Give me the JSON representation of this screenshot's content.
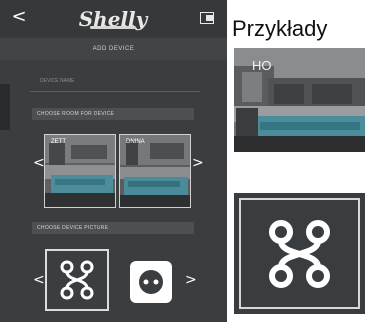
{
  "app": {
    "back_glyph": "<",
    "logo": "Shelly",
    "screen_title": "ADD DEVICE",
    "name_placeholder": "DEVICE NAME",
    "fullscreen_icon": "fullscreen-toggle-icon"
  },
  "rooms_section": {
    "label": "CHOOSE ROOM FOR DEVICE",
    "prev": "<",
    "next": ">",
    "rooms": [
      {
        "label": "ZETT"
      },
      {
        "label": "DNINA"
      }
    ]
  },
  "picture_section": {
    "label": "CHOOSE DEVICE PICTURE",
    "prev": "<",
    "next": ">",
    "options": [
      {
        "icon": "network-node-icon",
        "selected": true
      },
      {
        "icon": "power-socket-icon",
        "selected": false
      }
    ]
  },
  "examples": {
    "title": "Przykłady",
    "photo_label": "HO",
    "icon": "network-node-icon"
  },
  "colors": {
    "phone_bg": "#3b3e41",
    "topbar_bg": "#363839",
    "accent_light": "#d8d8d8"
  }
}
